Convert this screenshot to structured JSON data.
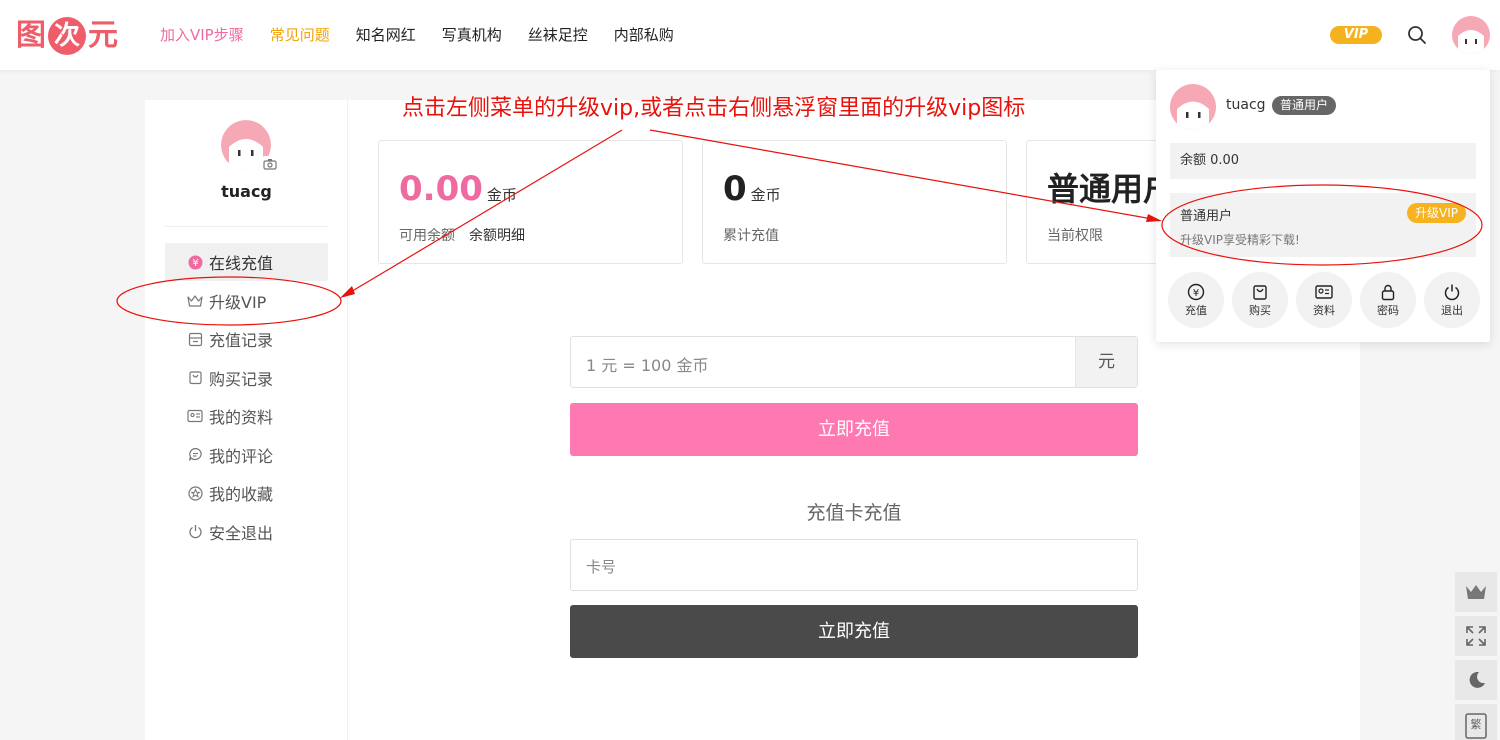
{
  "header": {
    "logo": [
      "图",
      "次",
      "元"
    ],
    "nav": [
      {
        "label": "加入VIP步骤",
        "style": "pink"
      },
      {
        "label": "常见问题",
        "style": "orange"
      },
      {
        "label": "知名网红",
        "style": ""
      },
      {
        "label": "写真机构",
        "style": ""
      },
      {
        "label": "丝袜足控",
        "style": ""
      },
      {
        "label": "内部私购",
        "style": ""
      }
    ],
    "vip_badge": "VIP"
  },
  "annotation": "点击左侧菜单的升级vip,或者点击右侧悬浮窗里面的升级vip图标",
  "sidebar": {
    "username": "tuacg",
    "items": [
      {
        "label": "在线充值",
        "icon": "yen-icon",
        "active": true
      },
      {
        "label": "升级VIP",
        "icon": "crown-icon",
        "active": false
      },
      {
        "label": "充值记录",
        "icon": "record-icon",
        "active": false
      },
      {
        "label": "购买记录",
        "icon": "bag-icon",
        "active": false
      },
      {
        "label": "我的资料",
        "icon": "profile-card-icon",
        "active": false
      },
      {
        "label": "我的评论",
        "icon": "comment-icon",
        "active": false
      },
      {
        "label": "我的收藏",
        "icon": "star-icon",
        "active": false
      },
      {
        "label": "安全退出",
        "icon": "power-icon",
        "active": false
      }
    ]
  },
  "stats": [
    {
      "value": "0.00",
      "unit": "金币",
      "label": "可用余额",
      "link": "余额明细",
      "color": "#ef6aa1"
    },
    {
      "value": "0",
      "unit": "金币",
      "label": "累计充值",
      "link": "",
      "color": "#222"
    },
    {
      "value": "普通用户",
      "unit": "",
      "label": "当前权限",
      "link": "",
      "color": "#222"
    }
  ],
  "recharge": {
    "amount_placeholder": "1 元 = 100 金币",
    "amount_suffix": "元",
    "submit_label": "立即充值",
    "card_section_title": "充值卡充值",
    "card_placeholder": "卡号",
    "card_submit_label": "立即充值"
  },
  "popup": {
    "username": "tuacg",
    "level": "普通用户",
    "balance": "余额 0.00",
    "vip_title": "普通用户",
    "vip_button": "升级VIP",
    "vip_desc": "升级VIP享受精彩下载!",
    "actions": [
      "充值",
      "购买",
      "资料",
      "密码",
      "退出"
    ]
  },
  "colors": {
    "pink": "#fe78b2",
    "annotation": "#e8120c",
    "vip": "#f5b21f"
  }
}
